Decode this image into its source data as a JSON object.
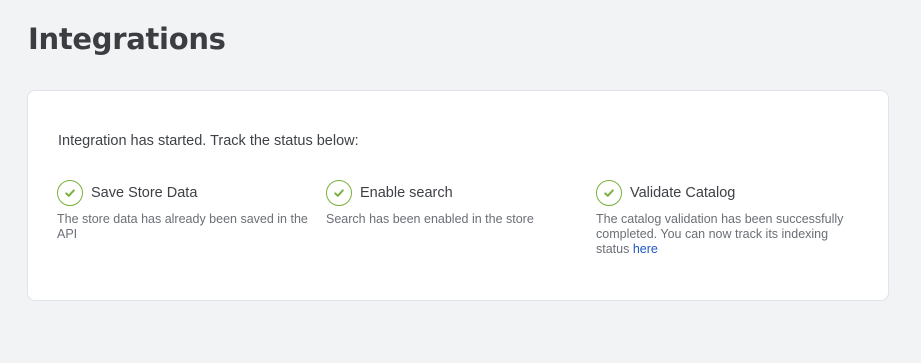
{
  "page": {
    "title": "Integrations"
  },
  "card": {
    "intro": "Integration has started. Track the status below:",
    "steps": [
      {
        "icon": "check-circle-icon",
        "title": "Save Store Data",
        "description": "The store data has already been saved in the API"
      },
      {
        "icon": "check-circle-icon",
        "title": "Enable search",
        "description": "Search has been enabled in the store"
      },
      {
        "icon": "check-circle-icon",
        "title": "Validate Catalog",
        "description": "The catalog validation has been successfully completed. You can now track its indexing status",
        "link_label": "here"
      }
    ]
  },
  "colors": {
    "success": "#79b13b",
    "link": "#1f57c3",
    "background": "#f2f3f5"
  }
}
